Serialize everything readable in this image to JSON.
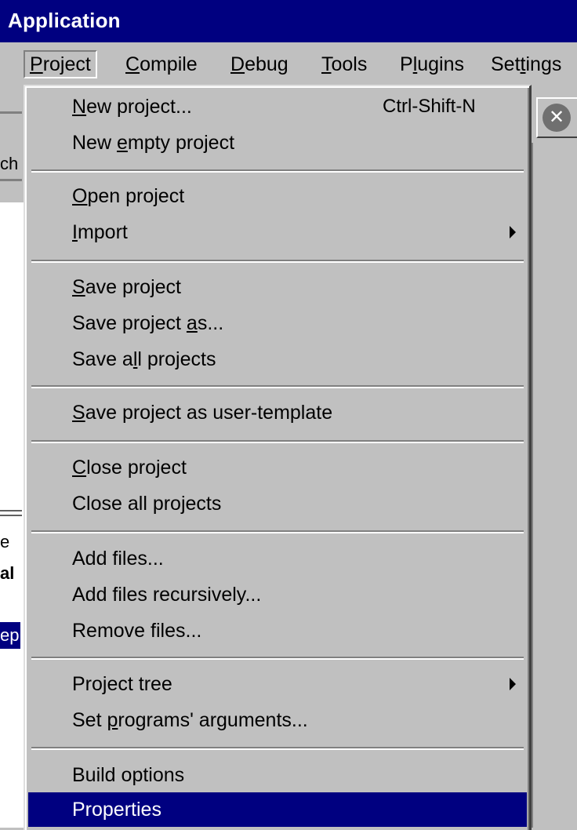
{
  "window": {
    "title": "Application"
  },
  "menubar": {
    "items": [
      {
        "label_pre": "",
        "mnemonic": "P",
        "label_post": "roject"
      },
      {
        "label_pre": "",
        "mnemonic": "C",
        "label_post": "ompile"
      },
      {
        "label_pre": "",
        "mnemonic": "D",
        "label_post": "ebug"
      },
      {
        "label_pre": "",
        "mnemonic": "T",
        "label_post": "ools"
      },
      {
        "label_pre": "P",
        "mnemonic": "l",
        "label_post": "ugins"
      },
      {
        "label_pre": "Set",
        "mnemonic": "t",
        "label_post": "ings"
      }
    ]
  },
  "background": {
    "text_ch": "ch",
    "text_e": "e",
    "text_al": "al",
    "text_ep": "ep",
    "close_glyph": "✕"
  },
  "menu": {
    "new_project": {
      "pre": "",
      "mn": "N",
      "post": "ew project...",
      "shortcut": "Ctrl-Shift-N"
    },
    "new_empty_project": {
      "pre": "New ",
      "mn": "e",
      "post": "mpty project"
    },
    "open_project": {
      "pre": "",
      "mn": "O",
      "post": "pen project"
    },
    "import": {
      "pre": "",
      "mn": "I",
      "post": "mport"
    },
    "save_project": {
      "pre": "",
      "mn": "S",
      "post": "ave project"
    },
    "save_project_as": {
      "pre": "Save project ",
      "mn": "a",
      "post": "s..."
    },
    "save_all_projects": {
      "pre": "Save a",
      "mn": "l",
      "post": "l projects"
    },
    "save_as_template": {
      "pre": "",
      "mn": "S",
      "post": "ave project as user-template"
    },
    "close_project": {
      "pre": "",
      "mn": "C",
      "post": "lose project"
    },
    "close_all_projects": {
      "pre": "Close all projects",
      "mn": "",
      "post": ""
    },
    "add_files": {
      "pre": "Add files...",
      "mn": "",
      "post": ""
    },
    "add_files_recursively": {
      "pre": "Add files recursively...",
      "mn": "",
      "post": ""
    },
    "remove_files": {
      "pre": "Remove files...",
      "mn": "",
      "post": ""
    },
    "project_tree": {
      "pre": "Project tree",
      "mn": "",
      "post": ""
    },
    "set_program_args": {
      "pre": "Set ",
      "mn": "p",
      "post": "rograms' arguments..."
    },
    "build_options": {
      "pre": "Build options",
      "mn": "",
      "post": ""
    },
    "properties": {
      "pre": "Properties",
      "mn": "",
      "post": ""
    }
  }
}
